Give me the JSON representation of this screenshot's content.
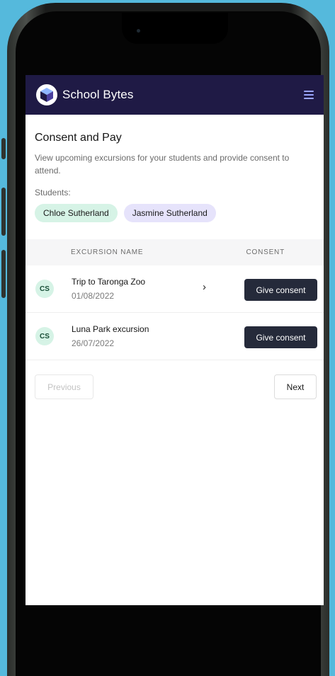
{
  "app": {
    "brand": "School Bytes",
    "colors": {
      "topbar": "#1f1a45",
      "accent_green": "#d6f3e6",
      "accent_purple": "#e6e3fb",
      "button_dark": "#252a3a",
      "background": "#55b9dc"
    }
  },
  "header": {
    "logo_icon": "school-bytes-cube-logo",
    "menu_icon": "hamburger-menu-icon"
  },
  "page": {
    "title": "Consent and Pay",
    "description": "View upcoming excursions for your students and provide consent to attend.",
    "students_label": "Students:",
    "students": [
      {
        "name": "Chloe Sutherland",
        "color": "#d6f3e6"
      },
      {
        "name": "Jasmine Sutherland",
        "color": "#e6e3fb"
      }
    ]
  },
  "table": {
    "headers": {
      "name": "EXCURSION NAME",
      "consent": "CONSENT"
    },
    "rows": [
      {
        "initials": "CS",
        "name": "Trip to Taronga Zoo",
        "date": "01/08/2022",
        "has_chevron": true,
        "action": "Give consent"
      },
      {
        "initials": "CS",
        "name": "Luna Park excursion",
        "date": "26/07/2022",
        "has_chevron": false,
        "action": "Give consent"
      }
    ]
  },
  "pagination": {
    "previous": "Previous",
    "next": "Next"
  }
}
